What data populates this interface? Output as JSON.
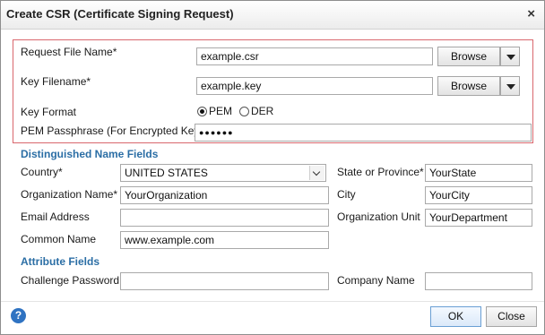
{
  "dialog": {
    "title": "Create CSR (Certificate Signing Request)",
    "close_glyph": "×"
  },
  "request": {
    "file_label": "Request File Name*",
    "file_value": "example.csr",
    "key_label": "Key Filename*",
    "key_value": "example.key",
    "browse_label": "Browse",
    "format_label": "Key Format",
    "format_options": [
      "PEM",
      "DER"
    ],
    "format_selected": "PEM",
    "passphrase_label": "PEM Passphrase (For Encrypted Key)",
    "passphrase_value": "●●●●●●"
  },
  "dn": {
    "section_label": "Distinguished Name Fields",
    "country_label": "Country*",
    "country_value": "UNITED STATES",
    "state_label": "State or Province*",
    "state_value": "YourState",
    "org_label": "Organization Name*",
    "org_value": "YourOrganization",
    "city_label": "City",
    "city_value": "YourCity",
    "email_label": "Email Address",
    "email_value": "",
    "unit_label": "Organization Unit",
    "unit_value": "YourDepartment",
    "cn_label": "Common Name",
    "cn_value": "www.example.com"
  },
  "attr": {
    "section_label": "Attribute Fields",
    "challenge_label": "Challenge Password",
    "challenge_value": "",
    "company_label": "Company Name",
    "company_value": ""
  },
  "footer": {
    "help_glyph": "?",
    "ok_label": "OK",
    "close_label": "Close"
  },
  "colors": {
    "section_text": "#2b6ea5",
    "highlight_border": "#d9676d",
    "help_icon": "#2f73c2"
  }
}
